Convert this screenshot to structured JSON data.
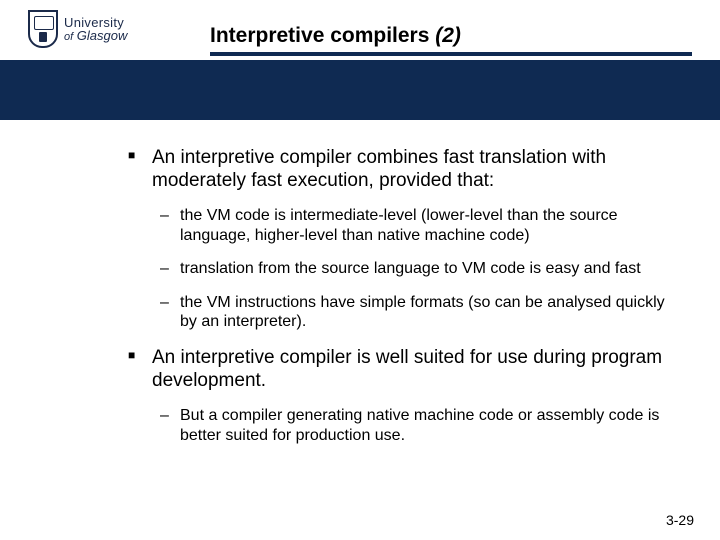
{
  "logo": {
    "line1": "University",
    "line2_of": "of",
    "line2_rest": " Glasgow"
  },
  "title": {
    "main": "Interpretive compilers ",
    "paren": "(2)"
  },
  "bullets": [
    {
      "level": 1,
      "text": "An interpretive compiler combines fast translation with moderately fast execution, provided that:"
    },
    {
      "level": 2,
      "text": "the VM code is intermediate-level (lower-level than the source language, higher-level than native machine code)"
    },
    {
      "level": 2,
      "text": "translation from the source language to VM code is easy and fast"
    },
    {
      "level": 2,
      "text": "the VM instructions have simple formats (so can be analysed quickly by an interpreter)."
    },
    {
      "level": 1,
      "text": "An interpretive compiler is well suited for use during program development."
    },
    {
      "level": 2,
      "text": "But a compiler generating native machine code or assembly code is better suited for production use."
    }
  ],
  "page_number": "3-29"
}
